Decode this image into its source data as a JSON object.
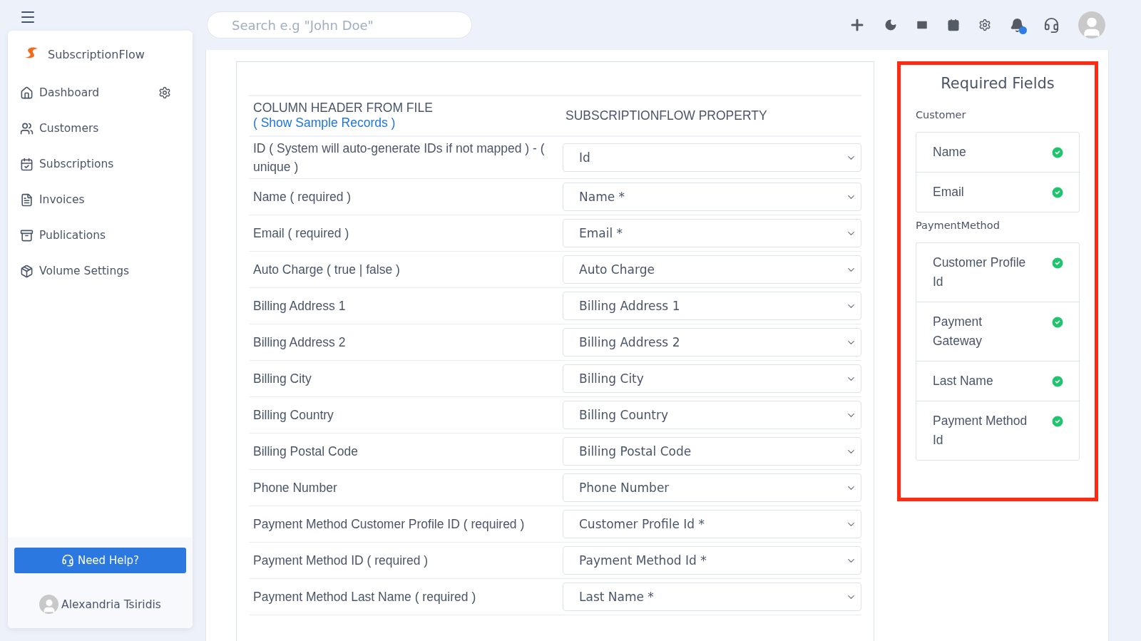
{
  "topbar": {
    "search": {
      "placeholder": "Search e.g \"John Doe\""
    }
  },
  "sidebar": {
    "brand": "SubscriptionFlow",
    "items": [
      {
        "label": "Dashboard"
      },
      {
        "label": "Customers"
      },
      {
        "label": "Subscriptions"
      },
      {
        "label": "Invoices"
      },
      {
        "label": "Publications"
      },
      {
        "label": "Volume Settings"
      }
    ],
    "help_button": "Need Help?",
    "user": "Alexandria Tsiridis"
  },
  "mapping": {
    "column_header": "COLUMN HEADER FROM FILE",
    "sample_link": "( Show Sample Records )",
    "property_header": "SUBSCRIPTIONFLOW PROPERTY",
    "rows": [
      {
        "label": "ID ( System will auto-generate IDs if not mapped ) - ( unique )",
        "value": "Id"
      },
      {
        "label": "Name ( required )",
        "value": "Name *"
      },
      {
        "label": "Email ( required )",
        "value": "Email *"
      },
      {
        "label": "Auto Charge ( true | false )",
        "value": "Auto Charge"
      },
      {
        "label": "Billing Address 1",
        "value": "Billing Address 1"
      },
      {
        "label": "Billing Address 2",
        "value": "Billing Address 2"
      },
      {
        "label": "Billing City",
        "value": "Billing City"
      },
      {
        "label": "Billing Country",
        "value": "Billing Country"
      },
      {
        "label": "Billing Postal Code",
        "value": "Billing Postal Code"
      },
      {
        "label": "Phone Number",
        "value": "Phone Number"
      },
      {
        "label": "Payment Method Customer Profile ID ( required )",
        "value": "Customer Profile Id *"
      },
      {
        "label": "Payment Method ID ( required )",
        "value": "Payment Method Id *"
      },
      {
        "label": "Payment Method Last Name ( required )",
        "value": "Last Name *"
      }
    ]
  },
  "required_fields": {
    "title": "Required Fields",
    "groups": [
      {
        "title": "Customer",
        "fields": [
          {
            "label": "Name",
            "mapped": true
          },
          {
            "label": "Email",
            "mapped": true
          }
        ]
      },
      {
        "title": "PaymentMethod",
        "fields": [
          {
            "label": "Customer Profile Id",
            "mapped": true
          },
          {
            "label": "Payment Gateway",
            "mapped": true
          },
          {
            "label": "Last Name",
            "mapped": true
          },
          {
            "label": "Payment Method Id",
            "mapped": true
          }
        ]
      }
    ]
  }
}
